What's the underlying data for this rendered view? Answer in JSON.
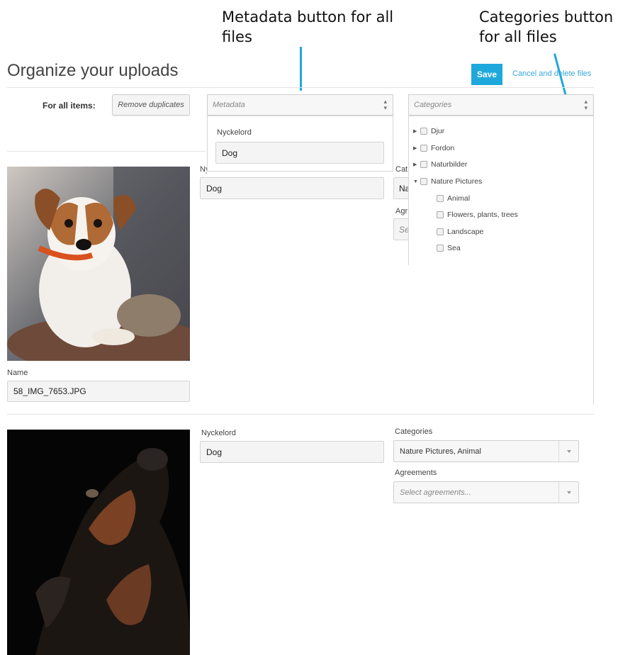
{
  "annotations": {
    "metadata_note": "Metadata button for all files",
    "categories_note": "Categories button for all files"
  },
  "header": {
    "title": "Organize your uploads",
    "save_label": "Save",
    "cancel_label": "Cancel and delete files"
  },
  "bulk": {
    "label": "For all items:",
    "remove_duplicates": "Remove duplicates",
    "metadata_placeholder": "Metadata",
    "categories_placeholder": "Categories",
    "metadata_dropdown": {
      "field_label": "Nyckelord",
      "field_value": "Dog"
    },
    "category_tree": [
      {
        "label": "Djur",
        "expanded": false,
        "checked": false
      },
      {
        "label": "Fordon",
        "expanded": false,
        "checked": false
      },
      {
        "label": "Naturbilder",
        "expanded": false,
        "checked": false
      },
      {
        "label": "Nature Pictures",
        "expanded": true,
        "checked": false,
        "children": [
          {
            "label": "Animal",
            "checked": false
          },
          {
            "label": "Flowers, plants, trees",
            "checked": false
          },
          {
            "label": "Landscape",
            "checked": false
          },
          {
            "label": "Sea",
            "checked": false
          }
        ]
      }
    ]
  },
  "items": [
    {
      "nyckelord_value": "Dog",
      "categories_partial": "Cat",
      "categories_value_partial": "Na",
      "agreements_partial": "Agr",
      "agreements_value_partial": "Se",
      "name_label": "Name",
      "name_value": "58_IMG_7653.JPG"
    },
    {
      "nyckelord_label": "Nyckelord",
      "nyckelord_value": "Dog",
      "categories_label": "Categories",
      "categories_value": "Nature Pictures, Animal",
      "agreements_label": "Agreements",
      "agreements_placeholder": "Select agreements..."
    }
  ],
  "icons": {
    "sort": "sort-updown-icon",
    "expand": "triangle-right-icon",
    "collapse": "triangle-down-icon",
    "dropdown": "caret-down-icon"
  },
  "colors": {
    "accent": "#1fa8dc",
    "link": "#3aa6dc"
  }
}
